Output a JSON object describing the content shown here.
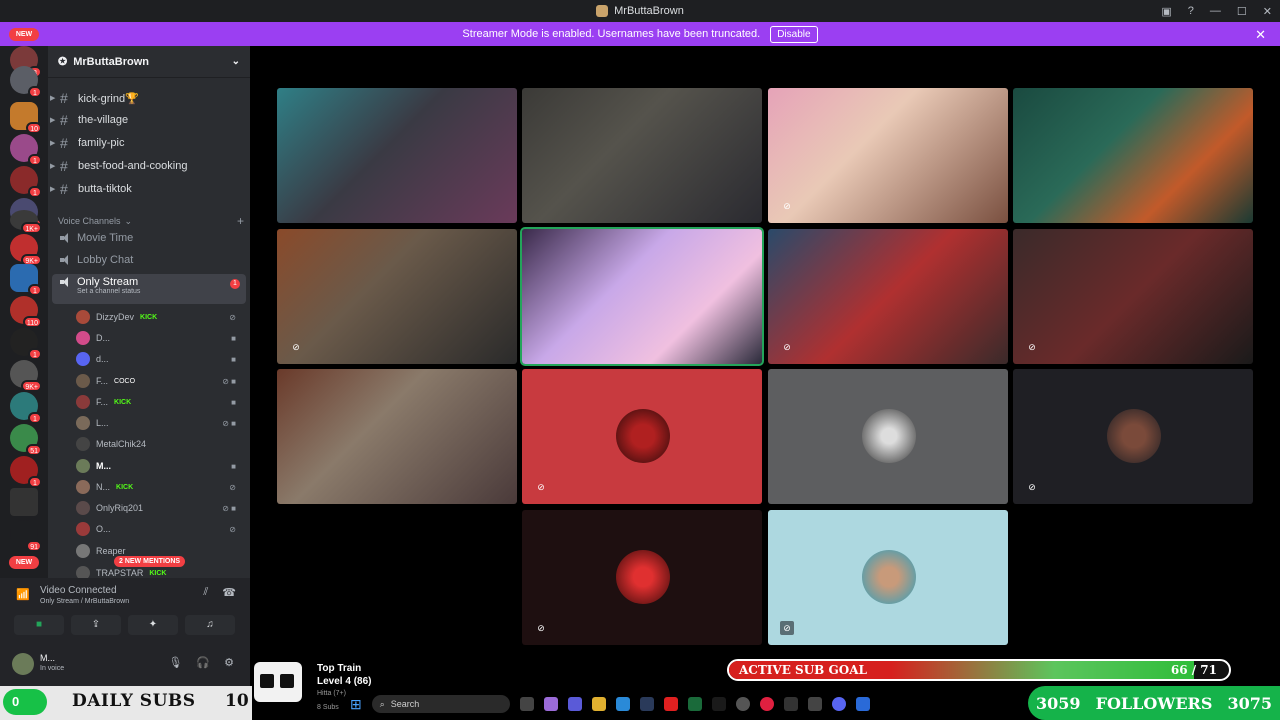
{
  "window": {
    "title": "MrButtaBrown"
  },
  "banner": {
    "text": "Streamer Mode is enabled. Usernames have been truncated.",
    "disable_label": "Disable"
  },
  "rail": {
    "new_top": "NEW",
    "new_bottom": "NEW",
    "badges": [
      "8",
      "1",
      "10",
      "1",
      "1",
      "1",
      "1K+",
      "9K+",
      "1",
      "110",
      "1",
      "9K+",
      "1",
      "51",
      "1",
      "91"
    ]
  },
  "sidebar": {
    "server_name": "MrButtaBrown",
    "text_channels": [
      "kick-grind🏆",
      "the-village",
      "family-pic",
      "best-food-and-cooking",
      "butta-tiktok"
    ],
    "voice_category": "Voice Channels",
    "voice_channels": [
      "Movie Time",
      "Lobby Chat"
    ],
    "active_voice": {
      "name": "Only Stream",
      "status": "Set a channel status",
      "badge": "1"
    },
    "voice_users": [
      {
        "name": "DizzyDev",
        "tag": "KICK"
      },
      {
        "name": "D...",
        "tag": ""
      },
      {
        "name": "d...",
        "tag": ""
      },
      {
        "name": "F...",
        "tag": "COCO"
      },
      {
        "name": "F...",
        "tag": "KICK"
      },
      {
        "name": "L...",
        "tag": ""
      },
      {
        "name": "MetalChik24",
        "tag": ""
      },
      {
        "name": "M...",
        "tag": ""
      },
      {
        "name": "N...",
        "tag": "KICK"
      },
      {
        "name": "OnlyRiq201",
        "tag": ""
      },
      {
        "name": "O...",
        "tag": ""
      },
      {
        "name": "Reaper",
        "tag": ""
      },
      {
        "name": "TRAPSTAR",
        "tag": "KICK"
      }
    ],
    "mentions": "2 NEW MENTIONS"
  },
  "voice_panel": {
    "title": "Video Connected",
    "subtitle": "Only Stream / MrButtaBrown"
  },
  "user_panel": {
    "name": "M...",
    "status": "In voice"
  },
  "overlay": {
    "daily_subs_label": "DAILY SUBS",
    "daily_subs_value": "10",
    "daily_subs_toggle": "0",
    "train_title": "Top Train",
    "train_level": "Level 4 (86)",
    "train_line3": "Hitta (7+)",
    "train_line4": "8 Subs",
    "sub_goal_label": "ACTIVE SUB GOAL",
    "sub_goal_count": "66 / 71",
    "sub_goal_progress": 0.93,
    "followers_left": "3059",
    "followers_label": "FOLLOWERS",
    "followers_right": "3075"
  },
  "taskbar": {
    "search_placeholder": "Search"
  },
  "colors": {
    "accent_banner": "#9b3ff2",
    "discord_green": "#23a55a",
    "kick_green": "#53fc18",
    "followers_green": "#15b34a"
  }
}
